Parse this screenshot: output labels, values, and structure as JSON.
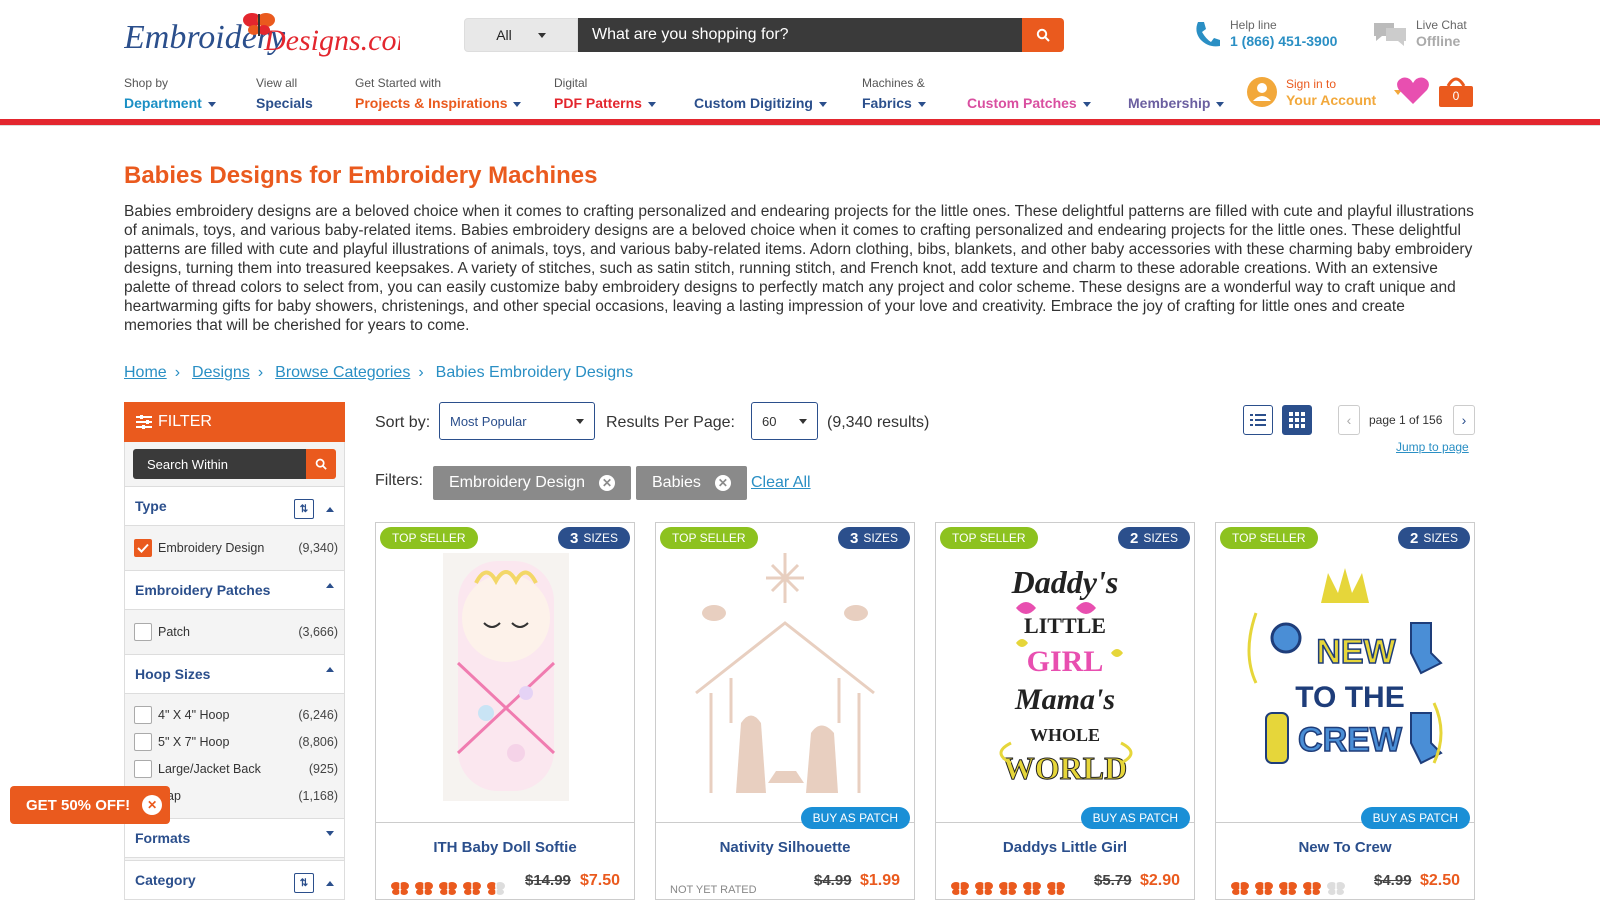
{
  "header": {
    "logo_text_left": "Embroidery",
    "logo_text_right": "Designs.com",
    "search": {
      "category": "All",
      "placeholder": "What are you shopping for?"
    },
    "help": {
      "label": "Help line",
      "phone": "1 (866) 451-3900"
    },
    "chat": {
      "label": "Live Chat",
      "status": "Offline"
    },
    "account": {
      "top": "Sign in to",
      "main": "Your Account"
    },
    "cart_count": "0"
  },
  "nav": [
    {
      "top": "Shop by",
      "main": "Department",
      "color": "#1a8fc4",
      "caret": true
    },
    {
      "top": "View all",
      "main": "Specials",
      "color": "#2b4f8c",
      "caret": false
    },
    {
      "top": "Get Started with",
      "main": "Projects & Inspirations",
      "color": "#ea5a1e",
      "caret": true
    },
    {
      "top": "Digital",
      "main": "PDF Patterns",
      "color": "#e3262e",
      "caret": true
    },
    {
      "top": "",
      "main": "Custom Digitizing",
      "color": "#2b4f8c",
      "caret": true
    },
    {
      "top": "Machines &",
      "main": "Fabrics",
      "color": "#2b4f8c",
      "caret": true
    },
    {
      "top": "",
      "main": "Custom Patches",
      "color": "#d94fa0",
      "caret": true
    },
    {
      "top": "",
      "main": "Membership",
      "color": "#6b5fa0",
      "caret": true
    }
  ],
  "page": {
    "title": "Babies Designs for Embroidery Machines",
    "intro": "Babies embroidery designs are a beloved choice when it comes to crafting personalized and endearing projects for the little ones. These delightful patterns are filled with cute and playful illustrations of animals, toys, and various baby-related items. Babies embroidery designs are a beloved choice when it comes to crafting personalized and endearing projects for the little ones. These delightful patterns are filled with cute and playful illustrations of animals, toys, and various baby-related items. Adorn clothing, bibs, blankets, and other baby accessories with these charming baby embroidery designs, turning them into treasured keepsakes. A variety of stitches, such as satin stitch, running stitch, and French knot, add texture and charm to these adorable creations. With an extensive palette of thread colors to select from, you can easily customize baby embroidery designs to perfectly match any project and color scheme. These designs are a wonderful way to craft unique and heartwarming gifts for baby showers, christenings, and other special occasions, leaving a lasting impression of your love and creativity. Embrace the joy of crafting for little ones and create memories that will be cherished for years to come."
  },
  "breadcrumb": [
    "Home",
    "Designs",
    "Browse Categories",
    "Babies Embroidery Designs"
  ],
  "sidebar": {
    "filter_label": "FILTER",
    "search_within": "Search Within",
    "sections": {
      "type": "Type",
      "patches": "Embroidery Patches",
      "hoop": "Hoop Sizes",
      "formats": "Formats",
      "category": "Category"
    },
    "type_options": [
      {
        "label": "Embroidery Design",
        "count": "(9,340)",
        "checked": true
      }
    ],
    "patch_options": [
      {
        "label": "Patch",
        "count": "(3,666)"
      }
    ],
    "hoop_options": [
      {
        "label": "4\" X 4\" Hoop",
        "count": "(6,246)"
      },
      {
        "label": "5\" X 7\" Hoop",
        "count": "(8,806)"
      },
      {
        "label": "Large/Jacket Back",
        "count": "(925)"
      },
      {
        "label": "Cap",
        "count": "(1,168)"
      }
    ]
  },
  "toolbar": {
    "sort_label": "Sort by:",
    "sort_value": "Most Popular",
    "per_page_label": "Results Per Page:",
    "per_page_value": "60",
    "results": "(9,340 results)",
    "page_info": "page 1 of 156",
    "jump": "Jump to page",
    "filters_label": "Filters:",
    "chips": [
      "Embroidery Design",
      "Babies"
    ],
    "clear_all": "Clear All"
  },
  "products": [
    {
      "name": "ITH Baby Doll Softie",
      "sizes": "3",
      "old": "$14.99",
      "new": "$7.50",
      "rating": 4.5,
      "rated": true
    },
    {
      "name": "Nativity Silhouette",
      "sizes": "3",
      "old": "$4.99",
      "new": "$1.99",
      "rating": 0,
      "rated": false
    },
    {
      "name": "Daddys Little Girl",
      "sizes": "2",
      "old": "$5.79",
      "new": "$2.90",
      "rating": 5,
      "rated": true
    },
    {
      "name": "New To Crew",
      "sizes": "2",
      "old": "$4.99",
      "new": "$2.50",
      "rating": 4,
      "rated": true
    }
  ],
  "card_labels": {
    "top_seller": "TOP SELLER",
    "sizes": "SIZES",
    "buy_patch": "BUY AS PATCH",
    "not_rated": "NOT YET RATED"
  },
  "promo": {
    "label": "GET 50% OFF!"
  },
  "art_text": {
    "daddys": [
      "Daddy's",
      "LITTLE",
      "GIRL",
      "Mama's",
      "WHOLE",
      "WORLD"
    ],
    "crew": [
      "NEW",
      "TO THE",
      "CREW"
    ]
  },
  "colors": {
    "orange": "#ea5a1e",
    "navy": "#2b4f8c",
    "blue": "#2a8fc4",
    "green": "#8dc21f",
    "red": "#e3262e"
  }
}
